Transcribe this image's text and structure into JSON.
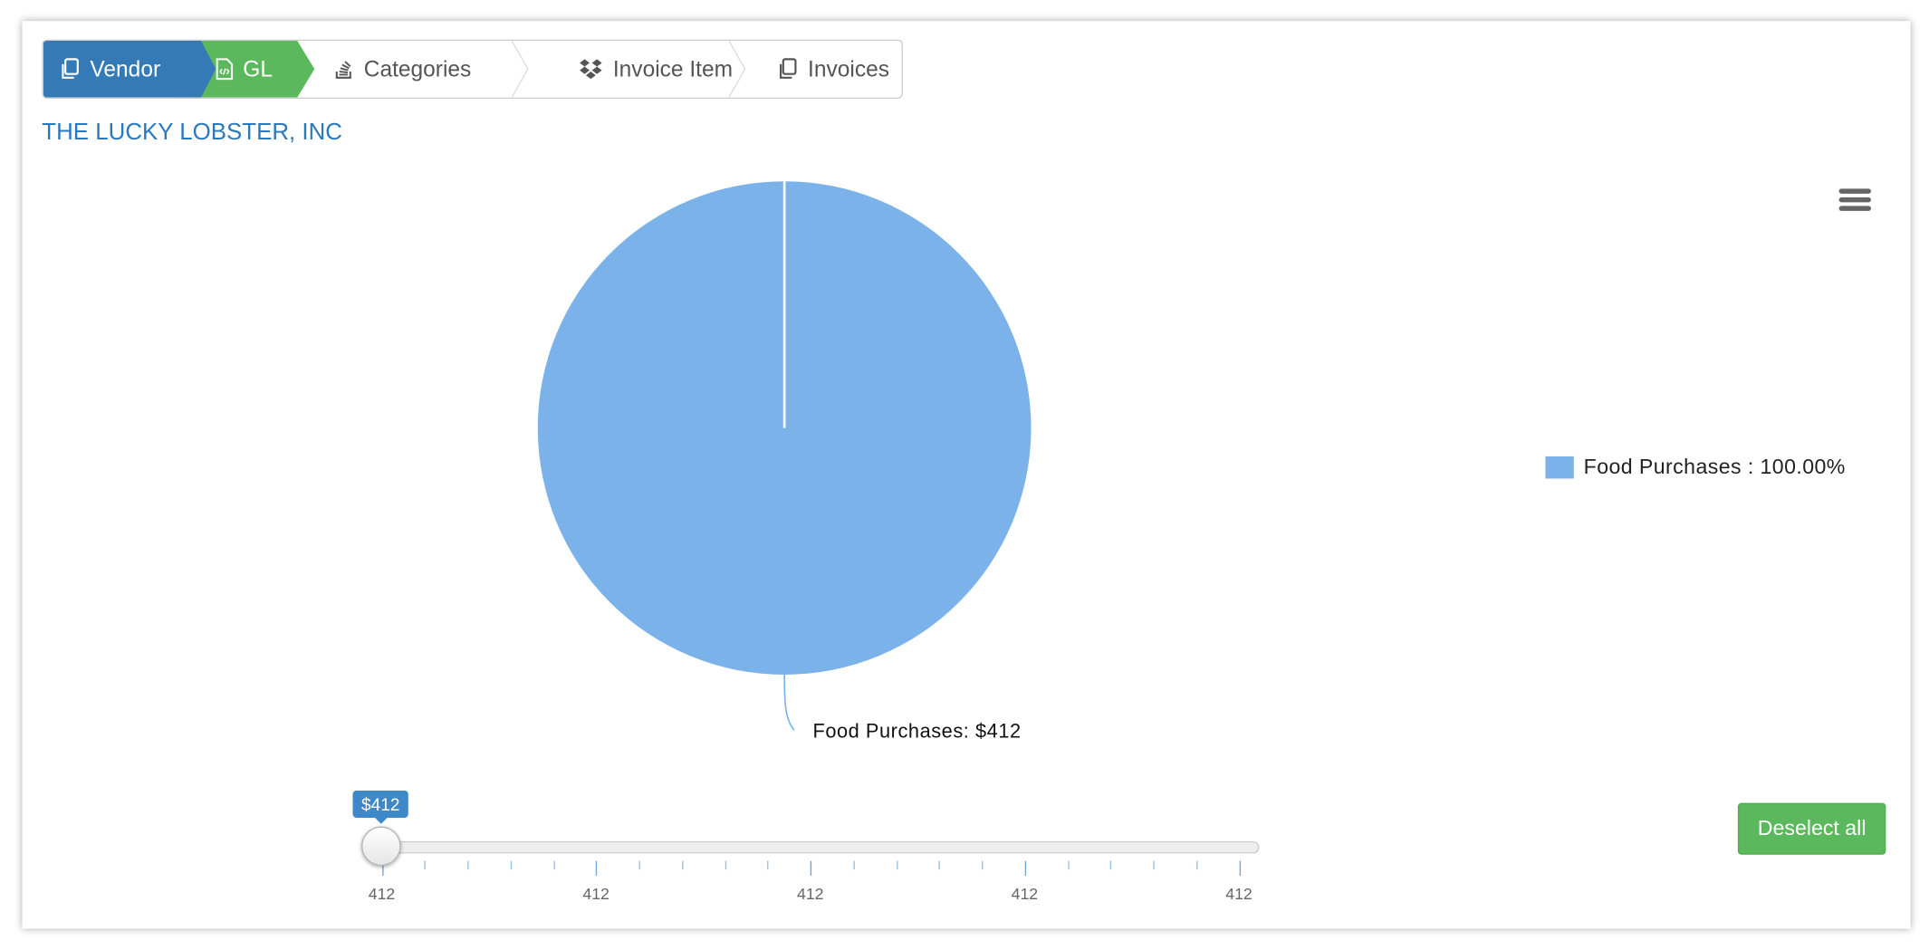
{
  "breadcrumb": {
    "vendor": "Vendor",
    "gl": "GL",
    "categories": "Categories",
    "invoice_item": "Invoice Item",
    "invoices": "Invoices"
  },
  "company_name": "THE LUCKY LOBSTER, INC",
  "chart_data": {
    "type": "pie",
    "slices": [
      {
        "name": "Food Purchases",
        "value": 412,
        "percent": 100.0,
        "color": "#7cb2ea"
      }
    ],
    "data_label": "Food Purchases: $412",
    "legend_label": "Food Purchases : 100.00%",
    "legend_position": "right"
  },
  "slider": {
    "tooltip": "$412",
    "value": 412,
    "min": 412,
    "max": 412,
    "tick_labels": [
      "412",
      "412",
      "412",
      "412",
      "412"
    ]
  },
  "buttons": {
    "deselect_all": "Deselect all"
  },
  "colors": {
    "vendor": "#337ab7",
    "gl": "#5cb85c",
    "slice": "#7cb2ea",
    "company": "#2a79bd"
  },
  "icons": {
    "vendor": "copy-icon",
    "gl": "code-file-icon",
    "categories": "stack-overflow-icon",
    "invoice_item": "dropbox-icon",
    "invoices": "copy-icon",
    "menu": "hamburger-menu-icon"
  }
}
